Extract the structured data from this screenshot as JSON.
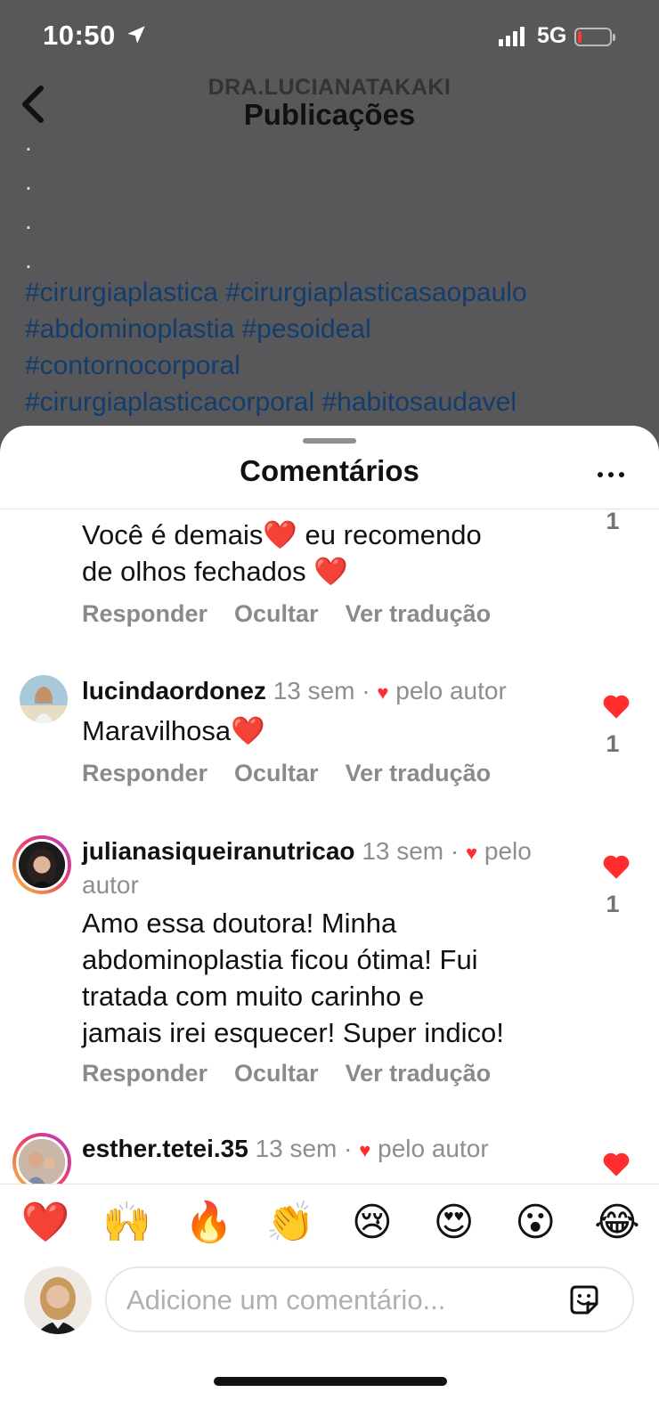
{
  "status_bar": {
    "time": "10:50",
    "network": "5G"
  },
  "header": {
    "username": "DRA.LUCIANATAKAKI",
    "title": "Publicações"
  },
  "caption": {
    "dots": [
      ".",
      ".",
      ".",
      "."
    ],
    "hashtag_lines": [
      "#cirurgiaplastica #cirurgiaplasticasaopaulo",
      "#abdominoplastia #pesoideal",
      "#contornocorporal",
      "#cirurgiaplasticacorporal #habitosaudavel"
    ]
  },
  "sheet": {
    "title": "Comentários"
  },
  "comments": [
    {
      "text_lines": [
        "Você é demais❤️ eu recomendo",
        "de olhos fechados ❤️"
      ],
      "actions": [
        "Responder",
        "Ocultar",
        "Ver tradução"
      ],
      "like_count": "1"
    },
    {
      "username": "lucindaordonez",
      "time": "13 sem",
      "sep": "·",
      "liked_by": "pelo autor",
      "text_lines": [
        "Maravilhosa❤️"
      ],
      "actions": [
        "Responder",
        "Ocultar",
        "Ver tradução"
      ],
      "like_count": "1"
    },
    {
      "username": "julianasiqueiranutricao",
      "time": "13 sem",
      "sep": "·",
      "liked_by": "pelo autor",
      "text_lines": [
        "Amo essa doutora! Minha",
        "abdominoplastia ficou ótima! Fui",
        "tratada com muito carinho e",
        "jamais irei esquecer! Super indico!"
      ],
      "actions": [
        "Responder",
        "Ocultar",
        "Ver tradução"
      ],
      "like_count": "1"
    },
    {
      "username": "esther.tetei.35",
      "time": "13 sem",
      "sep": "·",
      "liked_by": "pelo autor"
    }
  ],
  "reactions": [
    "❤️",
    "🙌",
    "🔥",
    "👏",
    "😢",
    "😍",
    "😮",
    "😂"
  ],
  "composer": {
    "placeholder": "Adicione um comentário..."
  },
  "colors": {
    "heart": "#ff2d2d",
    "link": "#123d6d",
    "muted": "#8e8e8e"
  },
  "icons": [
    "location-arrow-icon",
    "signal-icon",
    "battery-icon",
    "back-arrow-icon",
    "more-icon",
    "heart-icon",
    "sticker-icon"
  ]
}
